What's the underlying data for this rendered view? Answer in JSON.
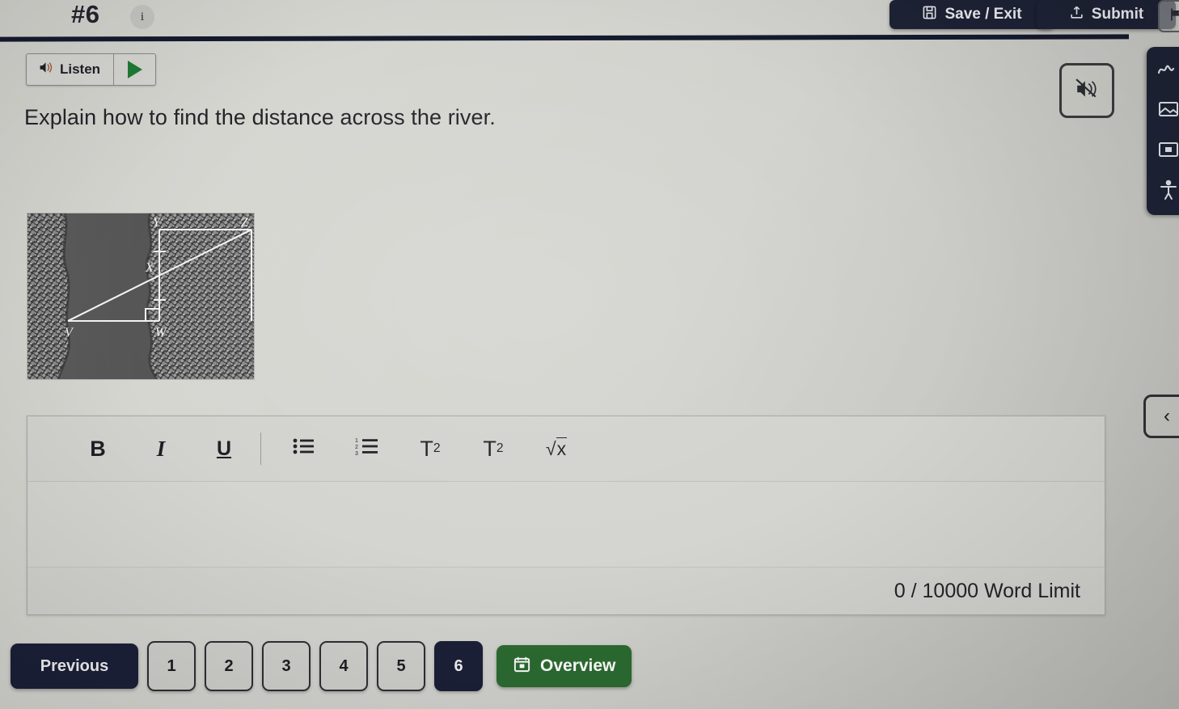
{
  "header": {
    "question_number": "#6",
    "info_icon": "info-icon",
    "save_exit_label": "Save / Exit",
    "save_icon": "floppy-disk-icon",
    "submit_label": "Submit",
    "submit_icon": "upload-icon",
    "flag_icon": "flag-icon"
  },
  "listen": {
    "label": "Listen",
    "speaker_icon": "speaker-icon",
    "play_icon": "play-icon"
  },
  "mute": {
    "icon": "speaker-muted-icon"
  },
  "question": {
    "text": "Explain how to find the distance across the river."
  },
  "figure": {
    "alt": "aerial photo of a river with geometric diagram overlay",
    "labels": {
      "v": "V",
      "w": "W",
      "x": "X",
      "y": "Y",
      "z": "Z"
    }
  },
  "editor": {
    "toolbar": [
      {
        "name": "bold-button",
        "label": "B"
      },
      {
        "name": "italic-button",
        "label": "I"
      },
      {
        "name": "underline-button",
        "label": "U"
      },
      {
        "name": "bullet-list-button",
        "label": "bullet-list-icon"
      },
      {
        "name": "numbered-list-button",
        "label": "numbered-list-icon"
      },
      {
        "name": "superscript-button",
        "label": "T2"
      },
      {
        "name": "subscript-button",
        "label": "T2"
      },
      {
        "name": "square-root-button",
        "label": "sqrt-x-icon"
      }
    ],
    "bold_label": "B",
    "italic_label": "I",
    "underline_label": "U",
    "superscript_base": "T",
    "superscript_exp": "2",
    "subscript_base": "T",
    "subscript_idx": "2",
    "sqrt_label": "x",
    "body_value": "",
    "body_placeholder": "",
    "word_limit": "0 / 10000 Word Limit"
  },
  "bottom_nav": {
    "previous_label": "Previous",
    "pages": [
      "1",
      "2",
      "3",
      "4",
      "5",
      "6"
    ],
    "active_page": "6",
    "overview_label": "Overview",
    "overview_icon": "calendar-grid-icon"
  },
  "right_rail": {
    "icons": [
      "draw-squiggle-icon",
      "image-annotate-icon",
      "note-card-icon",
      "accessibility-person-icon"
    ]
  },
  "collapse": {
    "icon": "chevron-left-icon"
  },
  "colors": {
    "navy": "#1d2235",
    "green": "#2c6b31",
    "page_bg": "#d2d2ce",
    "text": "#232429"
  }
}
